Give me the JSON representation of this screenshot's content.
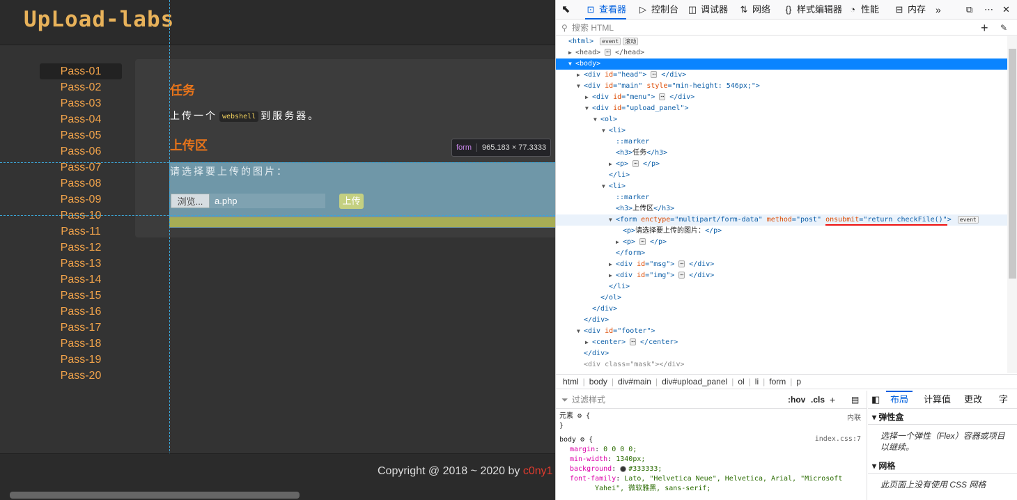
{
  "site": {
    "logo": "UpLoad-labs",
    "menu": [
      "Pass-01",
      "Pass-02",
      "Pass-03",
      "Pass-04",
      "Pass-05",
      "Pass-06",
      "Pass-07",
      "Pass-08",
      "Pass-09",
      "Pass-10",
      "Pass-11",
      "Pass-12",
      "Pass-13",
      "Pass-14",
      "Pass-15",
      "Pass-16",
      "Pass-17",
      "Pass-18",
      "Pass-19",
      "Pass-20"
    ],
    "active_menu": "Pass-01",
    "task_title": "任务",
    "task_text_before": "上传一个",
    "task_code": "webshell",
    "task_text_after": "到服务器。",
    "upload_title": "上传区",
    "choose_label": "请选择要上传的图片：",
    "browse_label": "浏览...",
    "file_name": "a.php",
    "upload_label": "上传",
    "copyright": "Copyright @ 2018 ~ 2020 by",
    "author": "c0ny1",
    "tooltip_tag": "form",
    "tooltip_size": "965.183 × 77.3333"
  },
  "devtools": {
    "tabs": [
      {
        "icon": "⊡",
        "label": "查看器",
        "active": true
      },
      {
        "icon": "▷",
        "label": "控制台"
      },
      {
        "icon": "◫",
        "label": "调试器"
      },
      {
        "icon": "⇅",
        "label": "网络"
      },
      {
        "icon": "{}",
        "label": "样式编辑器"
      },
      {
        "icon": "◔",
        "label": "性能"
      },
      {
        "icon": "⊟",
        "label": "内存"
      }
    ],
    "search_placeholder": "搜索 HTML",
    "breadcrumbs": [
      "html",
      "body",
      "div#main",
      "div#upload_panel",
      "ol",
      "li",
      "form",
      "p"
    ],
    "rules_filter_placeholder": "过滤样式",
    "rules_toggles": [
      ":hov",
      ".cls"
    ],
    "element_rule_label": "元素",
    "element_rule_source": "内联",
    "body_rule_selector": "body",
    "body_rule_source": "index.css:7",
    "body_props": [
      {
        "name": "margin",
        "value": "0 0 0 0;"
      },
      {
        "name": "min-width",
        "value": "1340px;"
      },
      {
        "name": "background",
        "value": "#333333;"
      },
      {
        "name": "font-family",
        "value": "Lato, \"Helvetica Neue\", Helvetica, Arial, \"Microsoft"
      },
      {
        "name": "",
        "value": "Yahei\", 微软雅黑, sans-serif;"
      }
    ],
    "layout_tabs": [
      "布局",
      "计算值",
      "更改",
      "字"
    ],
    "flex_title": "弹性盒",
    "flex_text": "选择一个弹性（Flex）容器或项目以继续。",
    "grid_title": "网格",
    "grid_text": "此页面上没有使用 CSS 网格"
  },
  "colors": {
    "accent": "#e8741a",
    "link": "#f0a24a",
    "highlight": "#6f97a8",
    "devtools_blue": "#0a84ff"
  }
}
